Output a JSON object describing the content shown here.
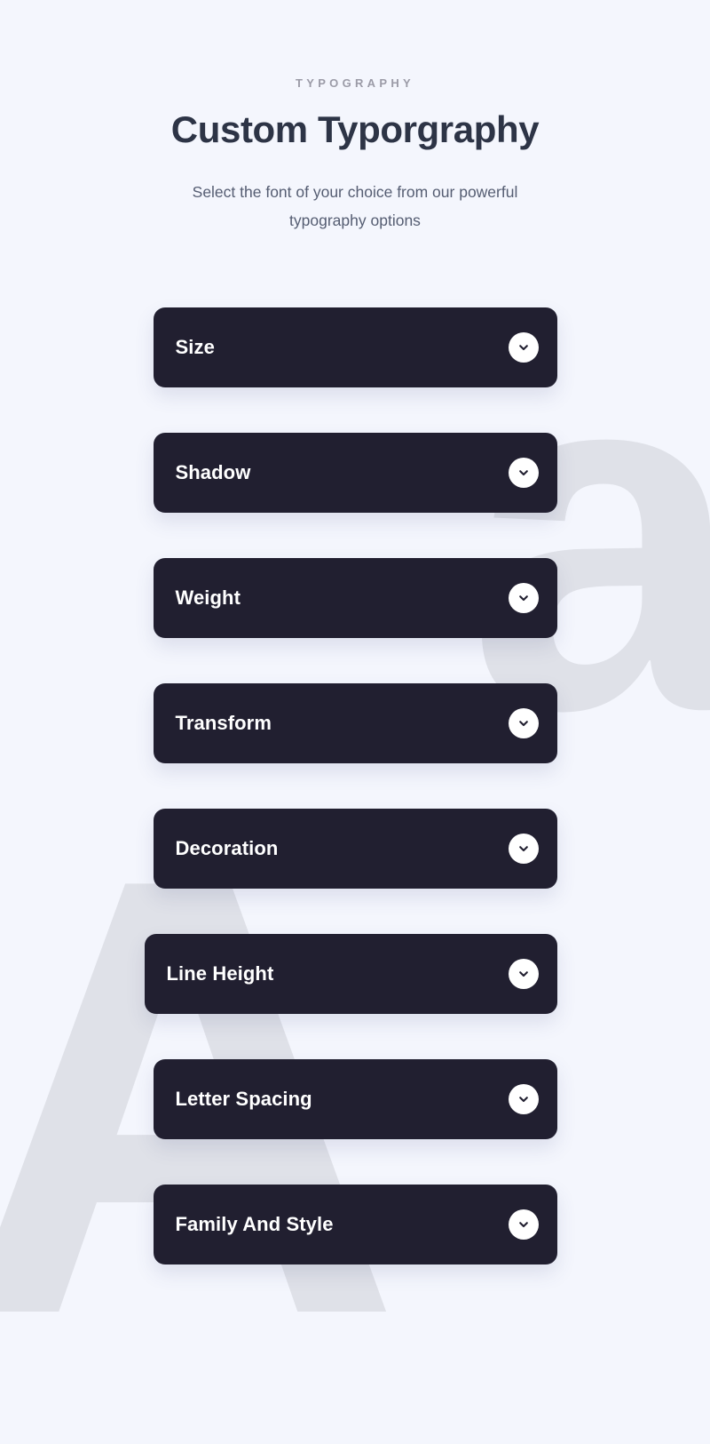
{
  "theme": {
    "background": "#f4f6fd",
    "card_background": "#211f30",
    "card_text": "#ffffff",
    "title_color": "#2d3446",
    "eyebrow_color": "#9b9ba7",
    "subtitle_color": "#555d72",
    "watermark_color": "#dfe1e8",
    "chevron_circle": "#ffffff"
  },
  "header": {
    "eyebrow": "TYPOGRAPHY",
    "title": "Custom Typorgraphy",
    "subtitle": "Select the font of your choice from our powerful typography options"
  },
  "decorations": [
    {
      "name": "watermark-letter-a-lowercase",
      "glyph": "a"
    },
    {
      "name": "watermark-letter-a-uppercase",
      "glyph": "A"
    }
  ],
  "accordion": {
    "expand_icon": "chevron-down-icon",
    "items": [
      {
        "label": "Size",
        "expanded": false
      },
      {
        "label": "Shadow",
        "expanded": false
      },
      {
        "label": "Weight",
        "expanded": false
      },
      {
        "label": "Transform",
        "expanded": false
      },
      {
        "label": "Decoration",
        "expanded": false
      },
      {
        "label": "Line Height",
        "expanded": false
      },
      {
        "label": "Letter Spacing",
        "expanded": false
      },
      {
        "label": "Family And Style",
        "expanded": false
      }
    ]
  }
}
